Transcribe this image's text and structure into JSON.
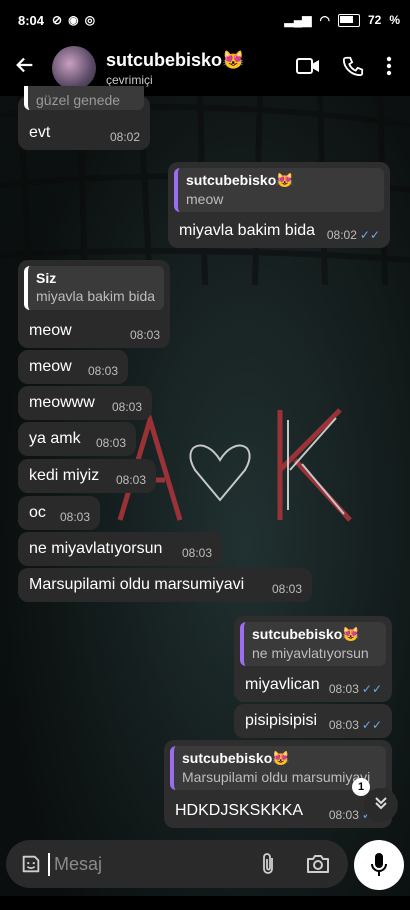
{
  "status_bar": {
    "time": "8:04",
    "battery": "72"
  },
  "header": {
    "name": "sutcubebisko😻",
    "status": "çevrimiçi"
  },
  "messages": [
    {
      "id": "m0",
      "text": "evt",
      "time": "08:02",
      "quote_partial": "güzel genede"
    },
    {
      "id": "m1",
      "quote_name": "sutcubebisko😻",
      "quote_text": "meow",
      "text": "miyavla bakim bida",
      "time": "08:02"
    },
    {
      "id": "m2",
      "quote_name": "Siz",
      "quote_text": "miyavla bakim bida",
      "text": "meow",
      "time": "08:03"
    },
    {
      "id": "m3",
      "text": "meow",
      "time": "08:03"
    },
    {
      "id": "m4",
      "text": "meowww",
      "time": "08:03"
    },
    {
      "id": "m5",
      "text": "ya amk",
      "time": "08:03"
    },
    {
      "id": "m6",
      "text": "kedi miyiz",
      "time": "08:03"
    },
    {
      "id": "m7",
      "text": "oc",
      "time": "08:03"
    },
    {
      "id": "m8",
      "text": "ne miyavlatıyorsun",
      "time": "08:03"
    },
    {
      "id": "m9",
      "text": "Marsupilami oldu marsumiyavi",
      "time": "08:03"
    },
    {
      "id": "m10",
      "quote_name": "sutcubebisko😻",
      "quote_text": "ne miyavlatıyorsun",
      "text": "miyavlican",
      "time": "08:03"
    },
    {
      "id": "m11",
      "text": "pisipisipisi",
      "time": "08:03"
    },
    {
      "id": "m12",
      "quote_name": "sutcubebisko😻",
      "quote_text": "Marsupilami oldu marsumiyavi",
      "text": "HDKDJSKSKKKA",
      "time": "08:03"
    }
  ],
  "scroll": {
    "unread_count": "1"
  },
  "composer": {
    "placeholder": "Mesaj"
  },
  "colors": {
    "accent_quote": "#9b6ef0",
    "read_ticks": "#6aa9f0",
    "bubble": "#2a2a2a"
  },
  "icons": [
    "back-arrow-icon",
    "video-call-icon",
    "phone-icon",
    "more-vert-icon",
    "sticker-icon",
    "attach-icon",
    "camera-icon",
    "mic-icon",
    "double-chevron-down-icon"
  ]
}
